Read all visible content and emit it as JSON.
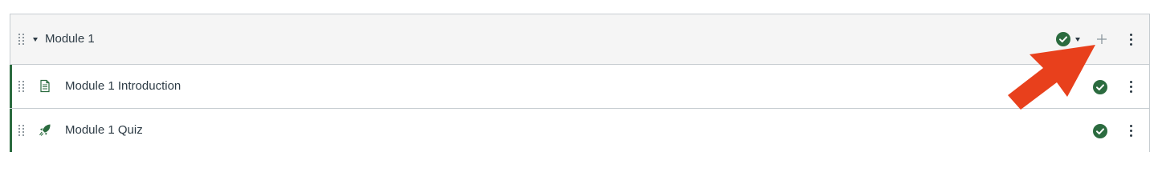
{
  "module": {
    "title": "Module 1",
    "status_icon": "published-check-icon",
    "actions": {
      "add_icon": "plus-icon",
      "more_icon": "kebab-menu-icon"
    }
  },
  "items": [
    {
      "title": "Module 1 Introduction",
      "type_icon": "page-document-icon",
      "status_icon": "published-check-icon"
    },
    {
      "title": "Module 1 Quiz",
      "type_icon": "quiz-rocket-icon",
      "status_icon": "published-check-icon"
    }
  ],
  "colors": {
    "published_green": "#2b6b3f",
    "annotation_arrow": "#e8401c",
    "header_bg": "#f5f5f5",
    "border": "#c7cdd1"
  }
}
